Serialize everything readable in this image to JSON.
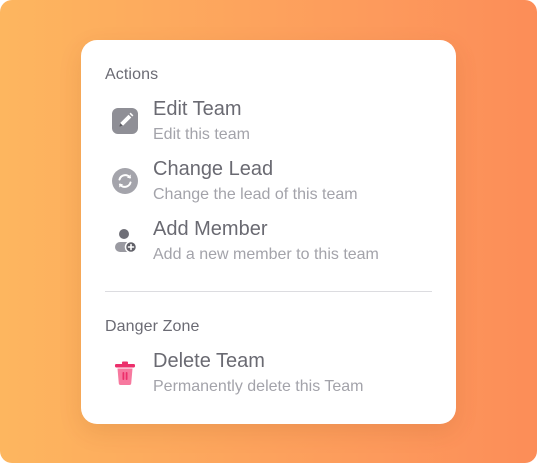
{
  "menu": {
    "actions_title": "Actions",
    "actions": [
      {
        "label": "Edit Team",
        "description": "Edit this team",
        "icon": "edit-icon"
      },
      {
        "label": "Change Lead",
        "description": "Change the lead of this team",
        "icon": "refresh-icon"
      },
      {
        "label": "Add Member",
        "description": "Add a new member to this team",
        "icon": "add-user-icon"
      }
    ],
    "danger_title": "Danger Zone",
    "danger": [
      {
        "label": "Delete Team",
        "description": "Permanently delete this Team",
        "icon": "trash-icon"
      }
    ]
  },
  "colors": {
    "background_start": "#fdb65f",
    "background_end": "#fc8d58",
    "icon_gray": "#8f8f96",
    "danger": "#f0407a"
  }
}
